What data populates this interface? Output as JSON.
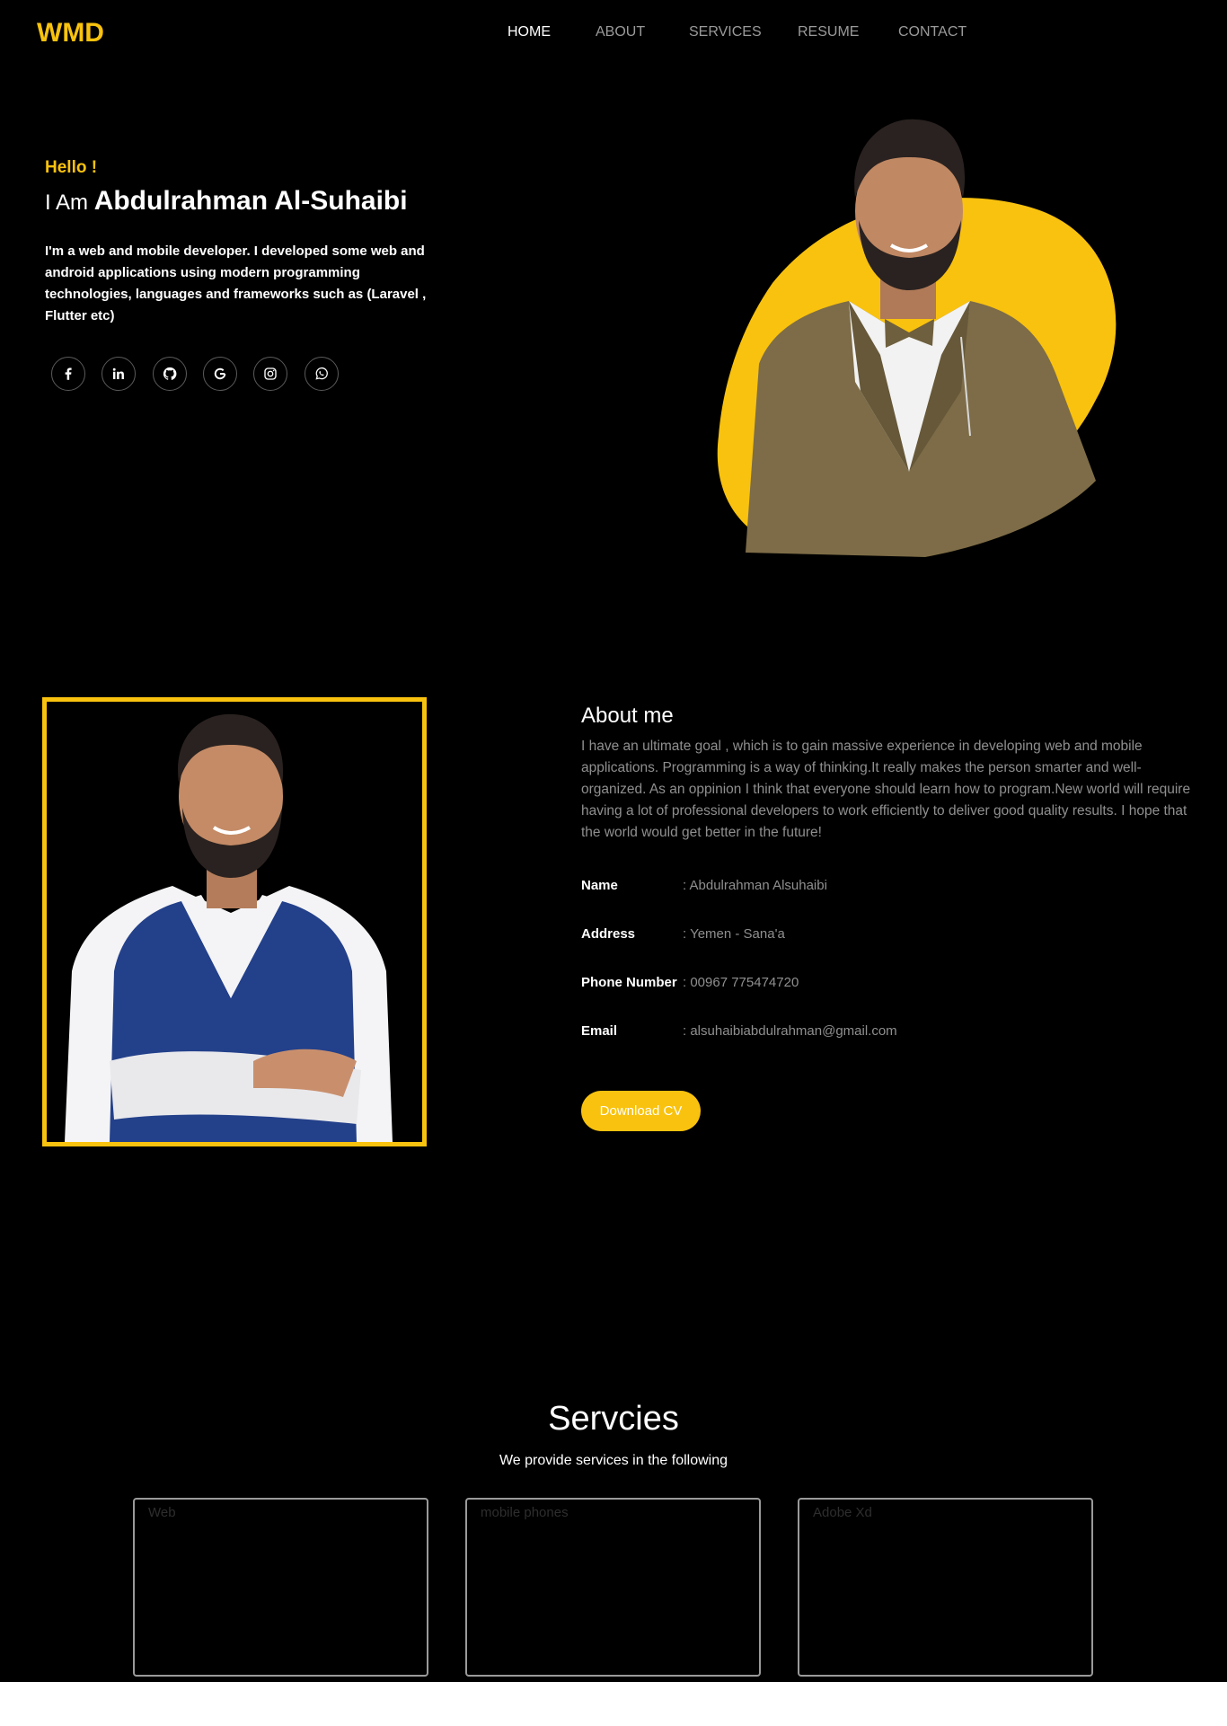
{
  "nav": {
    "logo": "WMD",
    "items": [
      {
        "label": "HOME",
        "active": true
      },
      {
        "label": "ABOUT",
        "active": false
      },
      {
        "label": "SERVICES",
        "active": false
      },
      {
        "label": "RESUME",
        "active": false
      },
      {
        "label": "CONTACT",
        "active": false
      }
    ]
  },
  "hero": {
    "greeting": "Hello !",
    "i_am": "I Am",
    "name": "Abdulrahman Al-Suhaibi",
    "intro": "I'm a web and mobile developer. I developed some web and android applications using modern programming technologies, languages and frameworks such as (Laravel , Flutter etc)",
    "socials": [
      "facebook-icon",
      "linkedin-icon",
      "github-icon",
      "google-icon",
      "instagram-icon",
      "whatsapp-icon"
    ]
  },
  "about": {
    "title": "About me",
    "text": "I have an ultimate goal , which is to gain massive experience in developing web and mobile applications. Programming is a way of thinking.It really makes the person smarter and well-organized. As an oppinion I think that everyone should learn how to program.New world will require having a lot of professional developers to work efficiently to deliver good quality results. I hope that the world would get better in the future!",
    "info": [
      {
        "label": "Name",
        "value": ": Abdulrahman Alsuhaibi"
      },
      {
        "label": "Address",
        "value": ": Yemen - Sana'a"
      },
      {
        "label": "Phone Number",
        "value": ": 00967 775474720"
      },
      {
        "label": "Email",
        "value": ": alsuhaibiabdulrahman@gmail.com"
      }
    ],
    "download_label": "Download CV"
  },
  "services": {
    "title": "Servcies",
    "subtitle": "We provide services in the following",
    "cards": [
      "Web",
      "mobile phones",
      "Adobe Xd"
    ]
  },
  "colors": {
    "accent": "#f9c20e",
    "background": "#000000",
    "muted_text": "#8f8f8f"
  }
}
